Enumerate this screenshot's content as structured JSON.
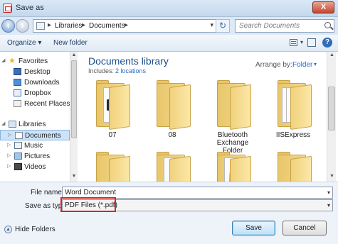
{
  "window": {
    "title": "Save as",
    "close_label": "X"
  },
  "address": {
    "crumbs": [
      "Libraries",
      "Documents"
    ],
    "search_placeholder": "Search Documents"
  },
  "toolbar": {
    "organize": "Organize ▾",
    "new_folder": "New folder",
    "help": "?"
  },
  "nav": {
    "favorites_header": "Favorites",
    "favorites": [
      "Desktop",
      "Downloads",
      "Dropbox",
      "Recent Places"
    ],
    "libraries_header": "Libraries",
    "libraries": [
      "Documents",
      "Music",
      "Pictures",
      "Videos"
    ],
    "selected": "Documents"
  },
  "library": {
    "title": "Documents library",
    "includes_label": "Includes:",
    "includes_link": "2 locations",
    "arrange_label": "Arrange by:",
    "arrange_value": "Folder"
  },
  "folders": [
    {
      "name": "07"
    },
    {
      "name": "08"
    },
    {
      "name": "Bluetooth Exchange Folder"
    },
    {
      "name": "IISExpress"
    },
    {
      "name": ""
    },
    {
      "name": ""
    },
    {
      "name": ""
    },
    {
      "name": ""
    }
  ],
  "form": {
    "file_name_label": "File name:",
    "file_name_value": "Word Document",
    "save_as_type_label": "Save as type:",
    "save_as_type_value": "PDF Files (*.pdf)",
    "hide_folders": "Hide Folders",
    "save_button": "Save",
    "cancel_button": "Cancel"
  },
  "colors": {
    "accent": "#2a6ac4",
    "highlight": "#e02020",
    "title": "#1b4f8c"
  }
}
